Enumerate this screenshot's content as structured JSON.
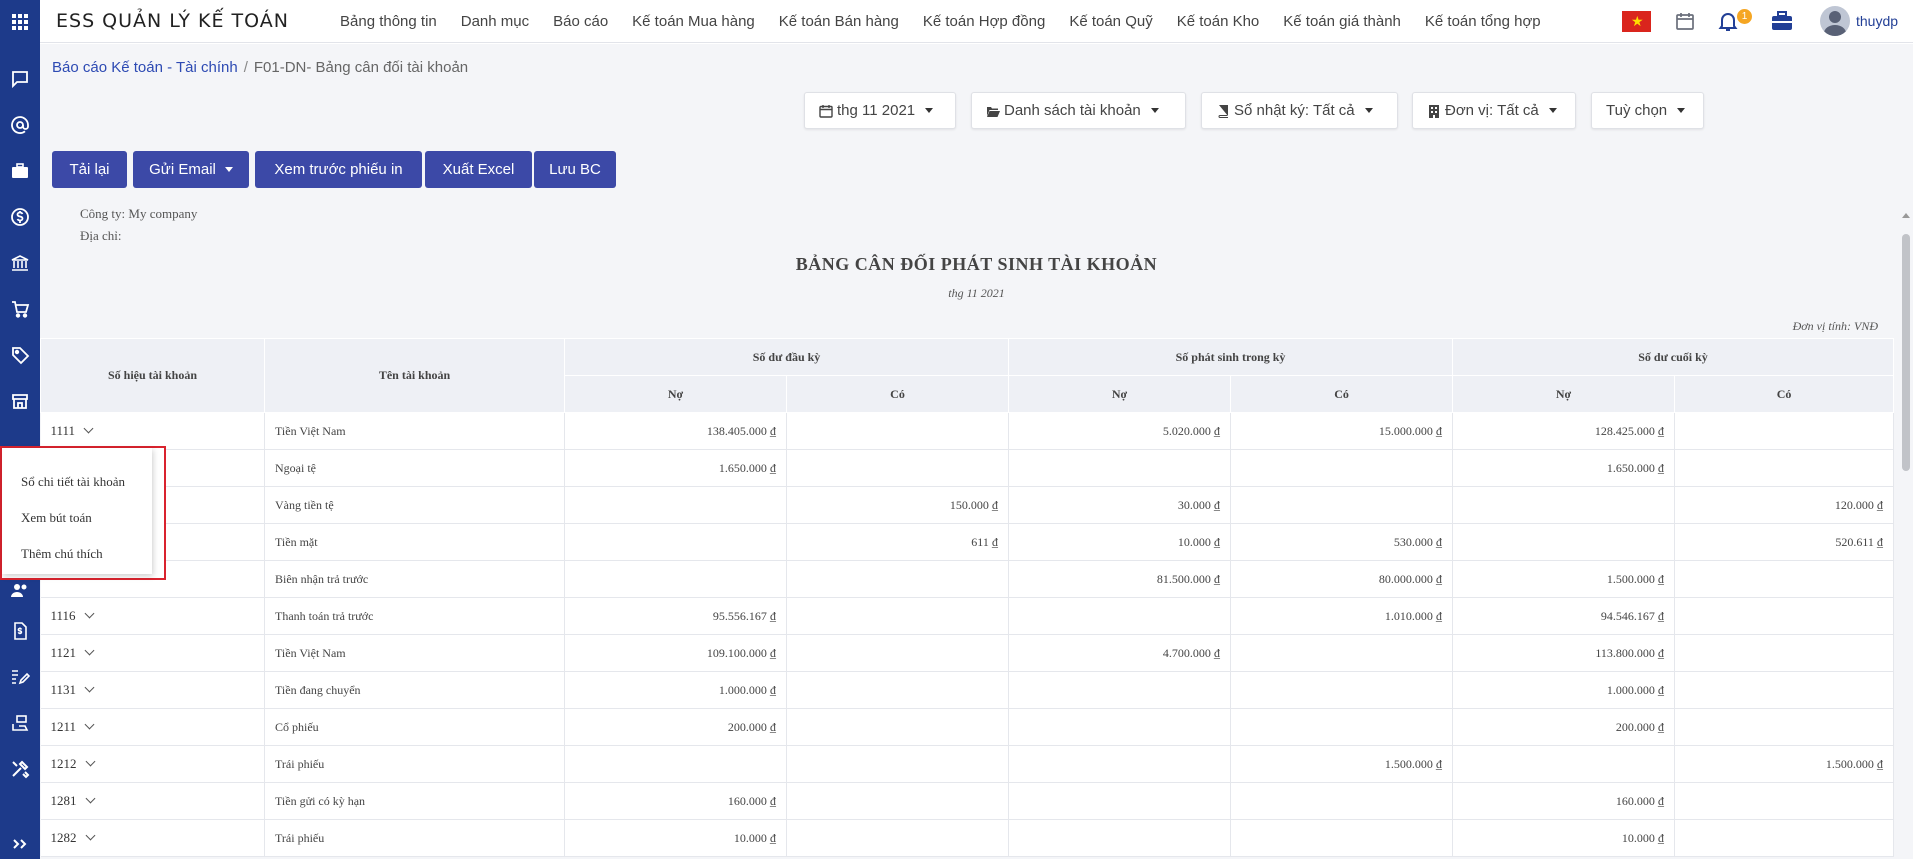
{
  "app": {
    "title": "ESS QUẢN LÝ KẾ TOÁN",
    "username": "thuydp",
    "notification_count": "1"
  },
  "nav": [
    "Bảng thông tin",
    "Danh mục",
    "Báo cáo",
    "Kế toán Mua hàng",
    "Kế toán Bán hàng",
    "Kế toán Hợp đồng",
    "Kế toán Quỹ",
    "Kế toán Kho",
    "Kế toán giá thành",
    "Kế toán tổng hợp"
  ],
  "breadcrumb": {
    "parent": "Báo cáo Kế toán - Tài chính",
    "separator": "/",
    "current": "F01-DN- Bảng cân đối tài khoản"
  },
  "filters": {
    "period": "thg 11 2021",
    "accounts": "Danh sách tài khoản",
    "journal": "Sổ nhật ký: Tất cả",
    "unit": "Đơn vị: Tất cả",
    "options": "Tuỳ chọn"
  },
  "buttons": {
    "reload": "Tải lại",
    "email": "Gửi Email",
    "preview": "Xem trước phiếu in",
    "excel": "Xuất Excel",
    "save": "Lưu BC"
  },
  "report": {
    "company": "Công ty: My company",
    "address": "Địa chỉ:",
    "title": "BẢNG CÂN ĐỐI PHÁT SINH TÀI KHOẢN",
    "period": "thg 11 2021",
    "unit_note": "Đơn vị tính: VNĐ",
    "headers": {
      "code": "Số hiệu tài khoản",
      "name": "Tên tài khoản",
      "opening": "Số dư đầu kỳ",
      "period": "Số phát sinh trong kỳ",
      "closing": "Số dư cuối kỳ",
      "debit": "Nợ",
      "credit": "Có"
    },
    "rows": [
      {
        "code": "1111",
        "name": "Tiền Việt Nam",
        "od": "138.405.000 ₫",
        "oc": "",
        "pd": "5.020.000 ₫",
        "pc": "15.000.000 ₫",
        "cd": "128.425.000 ₫",
        "cc": ""
      },
      {
        "code": "",
        "name": "Ngoại tệ",
        "od": "1.650.000 ₫",
        "oc": "",
        "pd": "",
        "pc": "",
        "cd": "1.650.000 ₫",
        "cc": ""
      },
      {
        "code": "",
        "name": "Vàng tiền tệ",
        "od": "",
        "oc": "150.000 ₫",
        "pd": "30.000 ₫",
        "pc": "",
        "cd": "",
        "cc": "120.000 ₫"
      },
      {
        "code": "",
        "name": "Tiền mặt",
        "od": "",
        "oc": "611 ₫",
        "pd": "10.000 ₫",
        "pc": "530.000 ₫",
        "cd": "",
        "cc": "520.611 ₫"
      },
      {
        "code": "",
        "name": "Biên nhận trả trước",
        "od": "",
        "oc": "",
        "pd": "81.500.000 ₫",
        "pc": "80.000.000 ₫",
        "cd": "1.500.000 ₫",
        "cc": ""
      },
      {
        "code": "1116",
        "name": "Thanh toán trả trước",
        "od": "95.556.167 ₫",
        "oc": "",
        "pd": "",
        "pc": "1.010.000 ₫",
        "cd": "94.546.167 ₫",
        "cc": ""
      },
      {
        "code": "1121",
        "name": "Tiền Việt Nam",
        "od": "109.100.000 ₫",
        "oc": "",
        "pd": "4.700.000 ₫",
        "pc": "",
        "cd": "113.800.000 ₫",
        "cc": ""
      },
      {
        "code": "1131",
        "name": "Tiền đang chuyển",
        "od": "1.000.000 ₫",
        "oc": "",
        "pd": "",
        "pc": "",
        "cd": "1.000.000 ₫",
        "cc": ""
      },
      {
        "code": "1211",
        "name": "Cổ phiếu",
        "od": "200.000 ₫",
        "oc": "",
        "pd": "",
        "pc": "",
        "cd": "200.000 ₫",
        "cc": ""
      },
      {
        "code": "1212",
        "name": "Trái phiếu",
        "od": "",
        "oc": "",
        "pd": "",
        "pc": "1.500.000 ₫",
        "cd": "",
        "cc": "1.500.000 ₫"
      },
      {
        "code": "1281",
        "name": "Tiền gửi có kỳ hạn",
        "od": "160.000 ₫",
        "oc": "",
        "pd": "",
        "pc": "",
        "cd": "160.000 ₫",
        "cc": ""
      },
      {
        "code": "1282",
        "name": "Trái phiếu",
        "od": "10.000 ₫",
        "oc": "",
        "pd": "",
        "pc": "",
        "cd": "10.000 ₫",
        "cc": ""
      }
    ]
  },
  "context_menu": [
    "Sổ chi tiết tài khoản",
    "Xem bút toán",
    "Thêm chú thích"
  ],
  "colors": {
    "sidebar": "#1d3a8a",
    "button": "#3c49a7",
    "highlight": "#d9232e",
    "badge": "#f5a623"
  }
}
